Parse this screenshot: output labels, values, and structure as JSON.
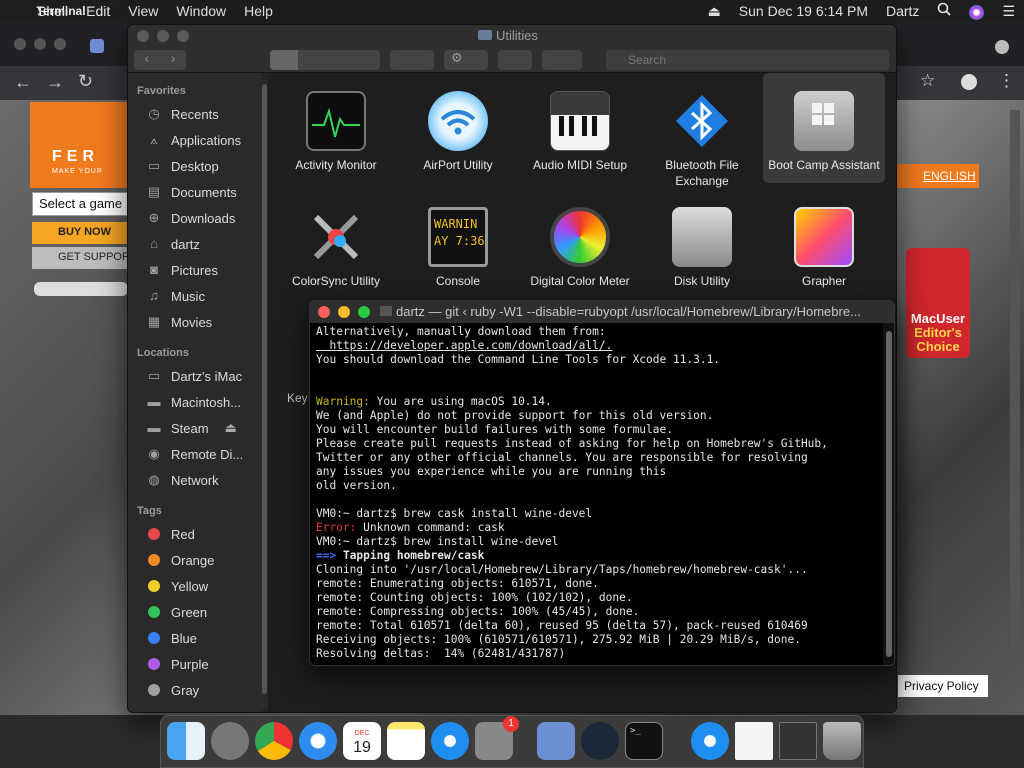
{
  "menubar": {
    "app": "Terminal",
    "items": [
      "Shell",
      "Edit",
      "View",
      "Window",
      "Help"
    ],
    "datetime": "Sun Dec 19  6:14 PM",
    "user": "Dartz"
  },
  "browser": {
    "select_label": "Select a game",
    "buy_label": "BUY NOW",
    "support_label": "GET SUPPORT",
    "lang_label": "ENGLISH",
    "badge_line1": "MacUser",
    "badge_line2": "Editor's",
    "badge_line3": "Choice",
    "privacy": "Privacy Policy",
    "key_text": "Key",
    "logo_text": "FER",
    "logo_sub": "MAKE YOUR"
  },
  "finder": {
    "title": "Utilities",
    "search_placeholder": "Search",
    "favorites_header": "Favorites",
    "favorites": [
      "Recents",
      "Applications",
      "Desktop",
      "Documents",
      "Downloads",
      "dartz",
      "Pictures",
      "Music",
      "Movies"
    ],
    "locations_header": "Locations",
    "locations": [
      "Dartz's iMac",
      "Macintosh...",
      "Steam",
      "Remote Di...",
      "Network"
    ],
    "tags_header": "Tags",
    "tags": [
      "Red",
      "Orange",
      "Yellow",
      "Green",
      "Blue",
      "Purple",
      "Gray"
    ],
    "apps_row1": [
      "Activity Monitor",
      "AirPort Utility",
      "Audio MIDI Setup",
      "Bluetooth File Exchange",
      "Boot Camp Assistant"
    ],
    "apps_row2": [
      "ColorSync Utility",
      "Console",
      "Digital Color Meter",
      "Disk Utility",
      "Grapher"
    ],
    "console_icon_text1": "WARNIN",
    "console_icon_text2": "AY 7:36"
  },
  "terminal": {
    "title": "dartz — git ‹ ruby -W1 --disable=rubyopt /usr/local/Homebrew/Library/Homebre...",
    "lines": [
      "Alternatively, manually download them from:",
      "  https://developer.apple.com/download/all/.",
      "You should download the Command Line Tools for Xcode 11.3.1.",
      "",
      "",
      "Warning: You are using macOS 10.14.",
      "We (and Apple) do not provide support for this old version.",
      "You will encounter build failures with some formulae.",
      "Please create pull requests instead of asking for help on Homebrew's GitHub,",
      "Twitter or any other official channels. You are responsible for resolving",
      "any issues you experience while you are running this",
      "old version.",
      "",
      "VM0:~ dartz$ brew cask install wine-devel",
      "Error: Unknown command: cask",
      "VM0:~ dartz$ brew install wine-devel",
      "==> Tapping homebrew/cask",
      "Cloning into '/usr/local/Homebrew/Library/Taps/homebrew/homebrew-cask'...",
      "remote: Enumerating objects: 610571, done.",
      "remote: Counting objects: 100% (102/102), done.",
      "remote: Compressing objects: 100% (45/45), done.",
      "remote: Total 610571 (delta 60), reused 95 (delta 57), pack-reused 610469",
      "Receiving objects: 100% (610571/610571), 275.92 MiB | 20.29 MiB/s, done.",
      "Resolving deltas:  14% (62481/431787)"
    ]
  },
  "dock": {
    "calendar_month": "DEC",
    "calendar_day": "19",
    "badge_count": "1"
  },
  "colors": {
    "tag_red": "#e5484d",
    "tag_orange": "#f08c2a",
    "tag_yellow": "#f0cf2a",
    "tag_green": "#35c25a",
    "tag_blue": "#3b82f6",
    "tag_purple": "#b05ce6",
    "tag_gray": "#a0a0a0"
  }
}
